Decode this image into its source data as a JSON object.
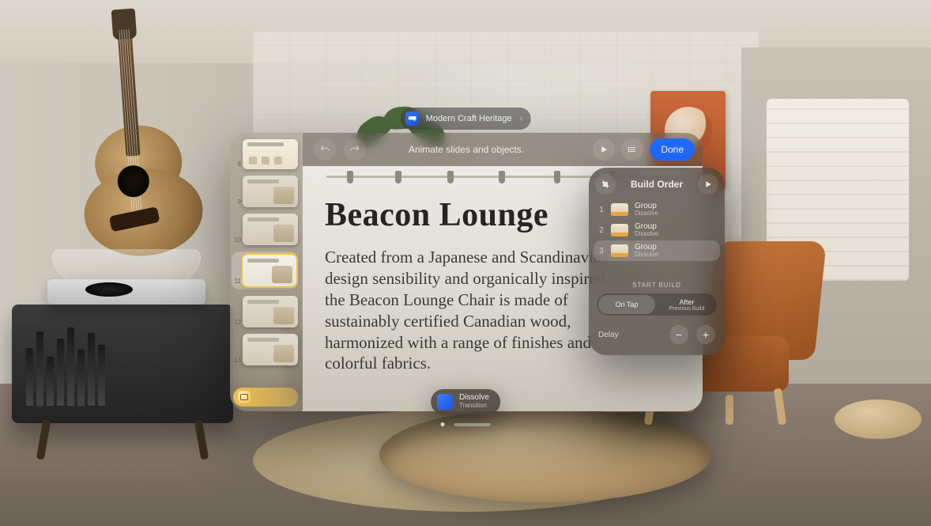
{
  "title_pill": {
    "app_name": "Modern Craft Heritage"
  },
  "toolbar": {
    "undo_aria": "Undo",
    "redo_aria": "Redo",
    "mode_label": "Animate slides and objects.",
    "play_aria": "Play",
    "list_aria": "View options",
    "done_label": "Done"
  },
  "thumbnails": {
    "items": [
      {
        "num": "8",
        "title": "Product Line"
      },
      {
        "num": "9",
        "title": "Beacon Lounge"
      },
      {
        "num": "10",
        "title": "Beacon Lounge"
      },
      {
        "num": "11",
        "title": "Beacon Lounge",
        "selected": true
      },
      {
        "num": "12",
        "title": "Beacon Lounge"
      },
      {
        "num": "13",
        "title": "Beacon Lounge"
      }
    ],
    "presenter_icon_aria": "Presenter display"
  },
  "slide": {
    "heading": "Beacon Lounge",
    "body": "Created from a Japanese and Scandinavian design sensibility and organically inspired arcs, the Beacon Lounge Chair is made of sustainably certified Canadian wood, harmonized with a range of finishes and colorful fabrics."
  },
  "build_panel": {
    "title": "Build Order",
    "crop_aria": "Builds",
    "preview_aria": "Preview builds",
    "rows": [
      {
        "n": "1",
        "title": "Group",
        "effect": "Dissolve"
      },
      {
        "n": "2",
        "title": "Group",
        "effect": "Dissolve"
      },
      {
        "n": "3",
        "title": "Group",
        "effect": "Dissolve",
        "selected": true
      }
    ],
    "section_label": "START BUILD",
    "seg_on_tap": "On Tap",
    "seg_after": "After",
    "seg_after_sub": "Previous Build",
    "delay_label": "Delay",
    "minus_aria": "Decrease delay",
    "plus_aria": "Increase delay"
  },
  "transition_chip": {
    "name": "Dissolve",
    "kind": "Transition"
  }
}
